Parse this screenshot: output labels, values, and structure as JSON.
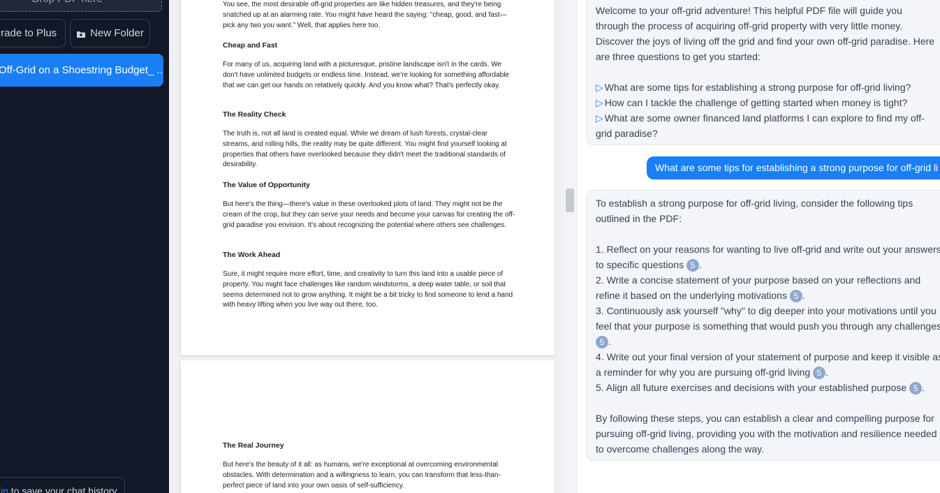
{
  "sidebar": {
    "dropzone_label": "Drop PDF here",
    "upgrade_label": "grade to Plus",
    "new_folder_label": "New Folder",
    "active_file": "Off-Grid on a Shoestring Budget_ ...",
    "save_hint_link": "in",
    "save_hint_text": " to save your chat history"
  },
  "pdf": {
    "page1": {
      "intro": "You see, the most desirable off-grid properties are like hidden treasures, and they're being snatched up at an alarming rate. You might have heard the saying: \"cheap, good, and fast—pick any two you want.\" Well, that applies here too.",
      "h1": "Cheap and Fast",
      "p1": "For many of us, acquiring land with a picturesque, pristine landscape isn't in the cards. We don't have unlimited budgets or endless time. Instead, we're looking for something affordable that we can get our hands on relatively quickly. And you know what? That's perfectly okay.",
      "h2": "The Reality Check",
      "p2": "The truth is, not all land is created equal. While we dream of lush forests, crystal-clear streams, and rolling hills, the reality may be quite different. You might find yourself looking at properties that others have overlooked because they didn't meet the traditional standards of desirability.",
      "h3": "The Value of Opportunity",
      "p3": "But here's the thing—there's value in these overlooked plots of land. They might not be the cream of the crop, but they can serve your needs and become your canvas for creating the off-grid paradise you envision. It's about recognizing the potential where others see challenges.",
      "h4": "The Work Ahead",
      "p4": "Sure, it might require more effort, time, and creativity to turn this land into a usable piece of property. You might face challenges like random windstorms, a deep water table, or soil that seems determined not to grow anything. It might be a bit tricky to find someone to lend a hand with heavy lifting when you live way out there, too."
    },
    "page2": {
      "h1": "The Real Journey",
      "p1": "But here's the beauty of it all: as humans, we're exceptional at overcoming environmental obstacles. With determination and a willingness to learn, you can transform that less-than-perfect piece of land into your own oasis of self-sufficiency."
    }
  },
  "chat": {
    "welcome_lines": [
      "Welcome to your off-grid adventure! This helpful PDF file will guide you",
      "through the process of acquiring off-grid property with very little money.",
      "Discover the joys of living off the grid and find your own off-grid paradise. Here",
      "are three questions to get you started:"
    ],
    "suggestions": [
      "What are some tips for establishing a strong purpose for off-grid living?",
      "How can I tackle the challenge of getting started when money is tight?",
      "What are some owner financed land platforms I can explore to find my off-"
    ],
    "suggestion_cont": "grid paradise?",
    "user_message": "What are some tips for establishing a strong purpose for off-grid li",
    "answer": {
      "intro_lines": [
        "To establish a strong purpose for off-grid living, consider the following tips",
        "outlined in the PDF:"
      ],
      "l1a": "1. Reflect on your reasons for wanting to live off-grid and write out your answers",
      "l1b": "to specific questions",
      "l2a": "2. Write a concise statement of your purpose based on your reflections and",
      "l2b": "refine it based on the underlying motivations",
      "l3a": "3. Continuously ask yourself \"why\" to dig deeper into your motivations until you",
      "l3b": "feel that your purpose is something that would push you through any challenges",
      "l4a": "4. Write out your final version of your statement of purpose and keep it visible as",
      "l4b": "a reminder for why you are pursuing off-grid living",
      "l5": "5. Align all future exercises and decisions with your established purpose",
      "outro_lines": [
        "By following these steps, you can establish a clear and compelling purpose for",
        "pursuing off-grid living, providing you with the motivation and resilience needed",
        "to overcome challenges along the way."
      ],
      "citation": "5"
    }
  }
}
